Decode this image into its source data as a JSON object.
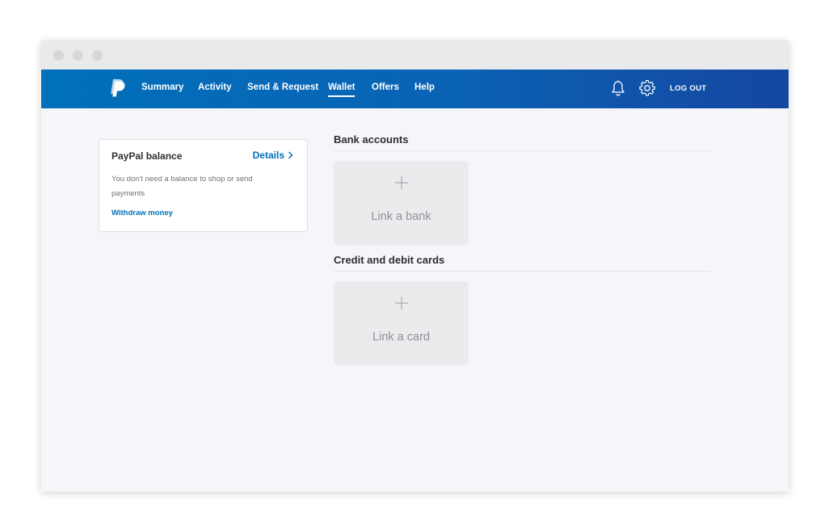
{
  "nav": {
    "items": [
      {
        "label": "Summary"
      },
      {
        "label": "Activity"
      },
      {
        "label": "Send & Request"
      },
      {
        "label": "Wallet"
      },
      {
        "label": "Offers"
      },
      {
        "label": "Help"
      }
    ],
    "active": "Wallet",
    "logout_label": "LOG OUT",
    "notification_icon": "bell-icon",
    "settings_icon": "gear-icon",
    "logo_icon": "paypal-logo"
  },
  "balance": {
    "title": "PayPal balance",
    "details_label": "Details",
    "description": "You don't need a balance to shop or send payments",
    "withdraw_label": "Withdraw money"
  },
  "bank_accounts": {
    "heading": "Bank accounts",
    "add_label": "Link a bank"
  },
  "cards": {
    "heading": "Credit and debit cards",
    "add_label": "Link a card"
  },
  "colors": {
    "brand_blue": "#0070ba",
    "nav_gradient_end": "#1546a0",
    "page_background": "#f5f6fa"
  }
}
